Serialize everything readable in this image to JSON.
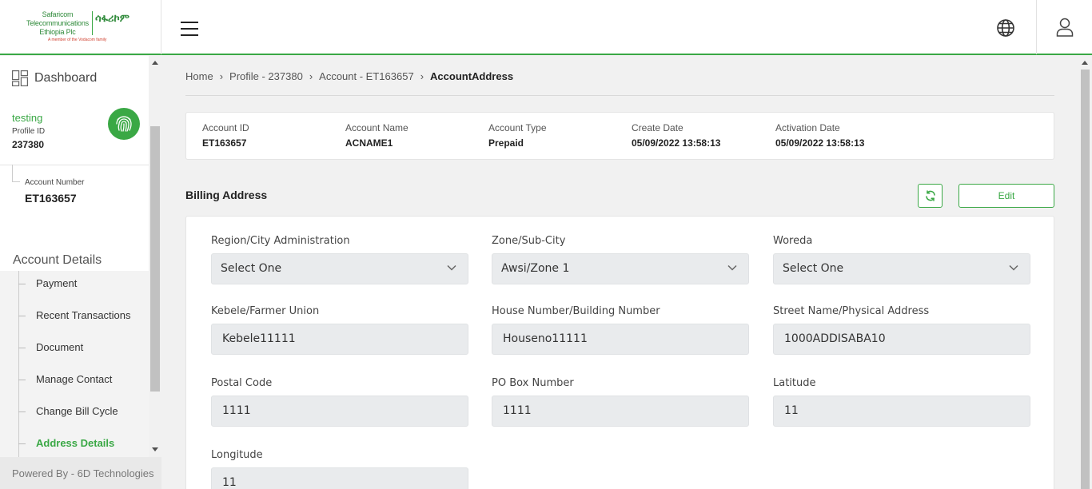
{
  "brand": {
    "name_en": "Safaricom Telecommunications Ethiopia Plc",
    "name_am": "ሳፋሪኮም",
    "tagline": "A member of the Vodacom family",
    "accent_color": "#3aa845"
  },
  "header": {
    "icons": [
      "menu-icon",
      "globe-icon",
      "user-icon"
    ]
  },
  "sidebar": {
    "dashboard_label": "Dashboard",
    "profile": {
      "name": "testing",
      "id_label": "Profile ID",
      "id_value": "237380"
    },
    "account": {
      "number_label": "Account Number",
      "number_value": "ET163657"
    },
    "section_title": "Account Details",
    "menu": [
      {
        "label": "Payment",
        "active": false
      },
      {
        "label": "Recent Transactions",
        "active": false
      },
      {
        "label": "Document",
        "active": false
      },
      {
        "label": "Manage Contact",
        "active": false
      },
      {
        "label": "Change Bill Cycle",
        "active": false
      },
      {
        "label": "Address Details",
        "active": true
      }
    ],
    "footer": "Powered By - 6D Technologies"
  },
  "breadcrumb": [
    "Home",
    "Profile - 237380",
    "Account - ET163657",
    "AccountAddress"
  ],
  "account_info": [
    {
      "label": "Account ID",
      "value": "ET163657"
    },
    {
      "label": "Account Name",
      "value": "ACNAME1"
    },
    {
      "label": "Account Type",
      "value": "Prepaid"
    },
    {
      "label": "Create Date",
      "value": "05/09/2022 13:58:13"
    },
    {
      "label": "Activation Date",
      "value": "05/09/2022 13:58:13"
    }
  ],
  "billing": {
    "title": "Billing Address",
    "edit_label": "Edit",
    "fields": [
      {
        "label": "Region/City Administration",
        "value": "Select One",
        "type": "select"
      },
      {
        "label": "Zone/Sub-City",
        "value": "Awsi/Zone 1",
        "type": "select"
      },
      {
        "label": "Woreda",
        "value": "Select One",
        "type": "select"
      },
      {
        "label": "Kebele/Farmer Union",
        "value": "Kebele11111",
        "type": "text"
      },
      {
        "label": "House Number/Building Number",
        "value": "Houseno11111",
        "type": "text"
      },
      {
        "label": "Street Name/Physical Address",
        "value": "1000ADDISABA10",
        "type": "text"
      },
      {
        "label": "Postal Code",
        "value": "1111",
        "type": "text"
      },
      {
        "label": "PO Box Number",
        "value": "1111",
        "type": "text"
      },
      {
        "label": "Latitude",
        "value": "11",
        "type": "text"
      },
      {
        "label": "Longitude",
        "value": "11",
        "type": "text"
      }
    ]
  }
}
